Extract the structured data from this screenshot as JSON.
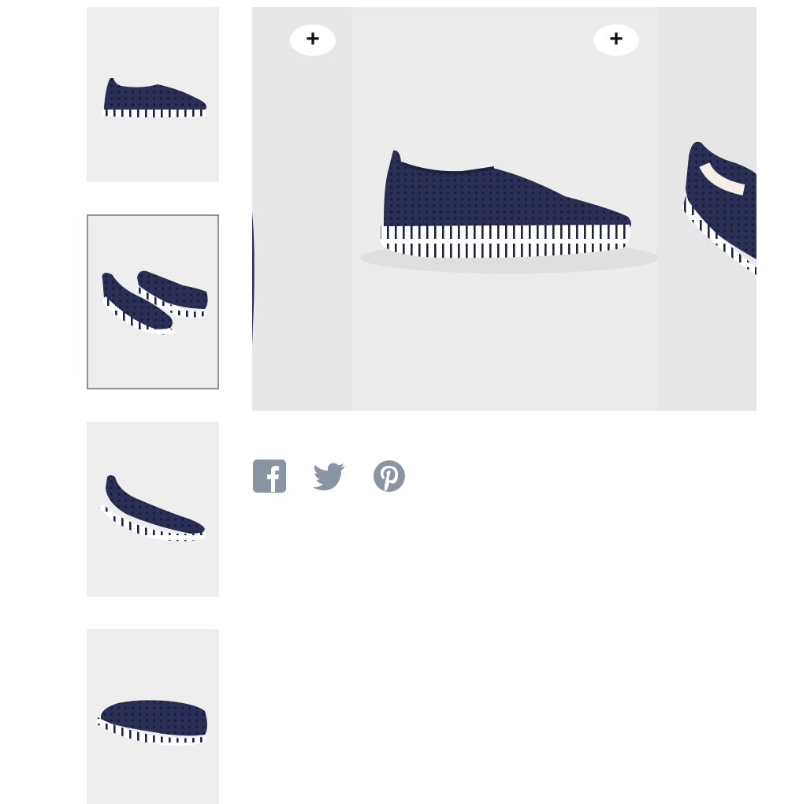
{
  "gallery": {
    "thumbnails": [
      {
        "icon": "shoe-side-view",
        "active": false
      },
      {
        "icon": "shoe-pair-view",
        "active": true
      },
      {
        "icon": "shoe-three-quarter-view",
        "active": false
      },
      {
        "icon": "shoe-rear-view",
        "active": false
      }
    ],
    "main_image": {
      "icon": "navy-perforated-slip-on-shoe"
    },
    "zoom_buttons": [
      {
        "label": "+"
      },
      {
        "label": "+"
      }
    ]
  },
  "share": [
    {
      "icon": "facebook-icon"
    },
    {
      "icon": "twitter-icon"
    },
    {
      "icon": "pinterest-icon"
    }
  ],
  "colors": {
    "navy": "#2b2f55",
    "sole": "#ffffff",
    "photo_bg": "#ececec",
    "share_icon": "#8a94a3",
    "active_border": "#8a8f99"
  }
}
